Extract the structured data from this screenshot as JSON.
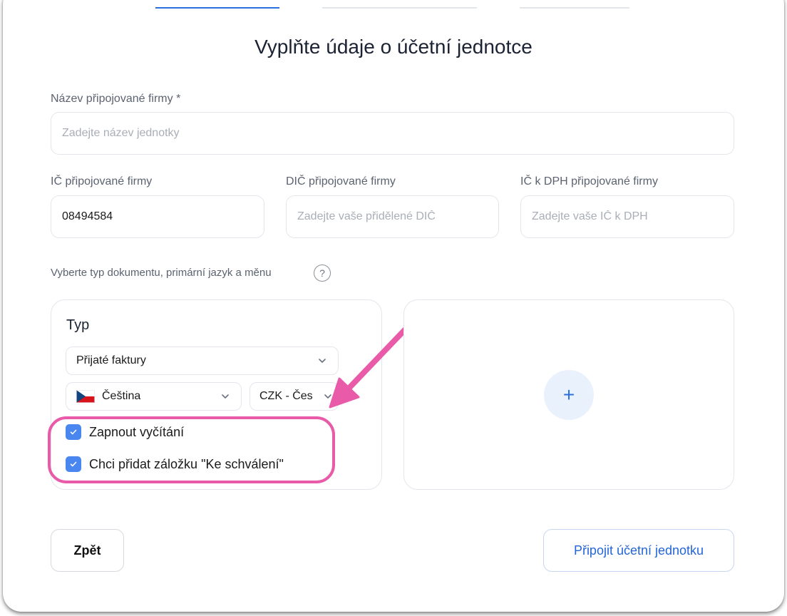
{
  "title": "Vyplňte údaje o účetní jednotce",
  "fields": {
    "name_label": "Název připojované firmy *",
    "name_placeholder": "Zadejte název jednotky",
    "ic_label": "IČ připojované firmy",
    "ic_value": "08494584",
    "dic_label": "DIČ připojované firmy",
    "dic_placeholder": "Zadejte vaše přidělené DIČ",
    "icdph_label": "IČ k DPH připojované firmy",
    "icdph_placeholder": "Zadejte vaše IČ k DPH"
  },
  "doc_section": {
    "label": "Vyberte typ dokumentu, primární jazyk a měnu",
    "help": "?"
  },
  "type_panel": {
    "title": "Typ",
    "document_type": "Přijaté faktury",
    "language": "Čeština",
    "currency": "CZK - Čes",
    "check_reading": "Zapnout vyčítání",
    "check_approval": "Chci přidat záložku \"Ke schválení\""
  },
  "add_panel": {
    "add_symbol": "+"
  },
  "buttons": {
    "back": "Zpět",
    "connect": "Připojit účetní jednotku"
  },
  "colors": {
    "accent": "#2a6fdb",
    "checkbox": "#4a86f0",
    "highlight": "#e95aa8"
  }
}
